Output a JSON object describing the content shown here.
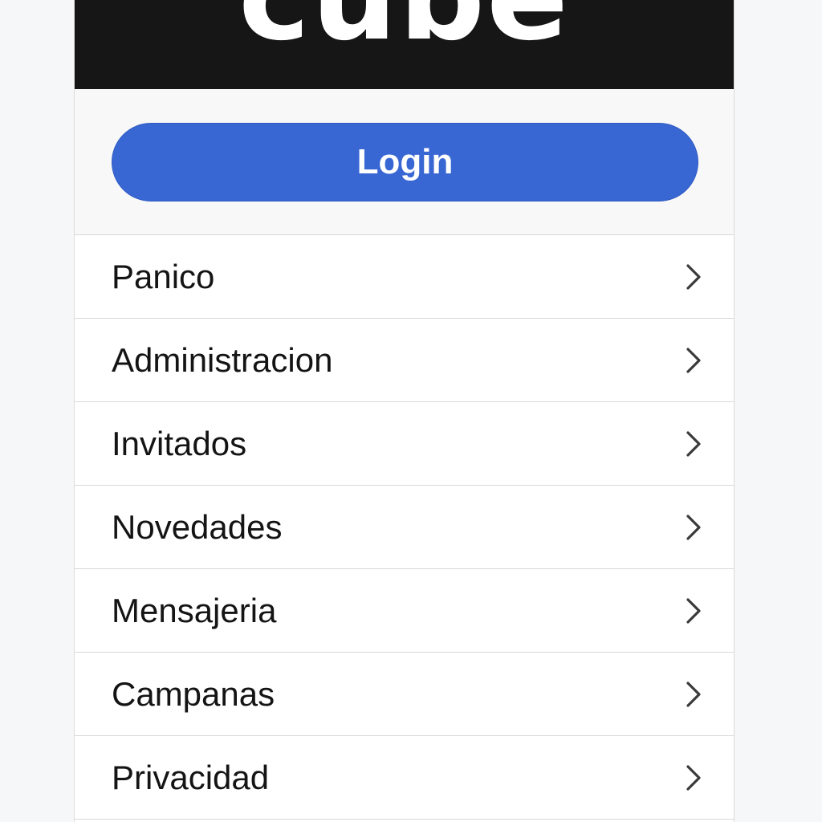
{
  "header": {
    "logo_text": "cube",
    "background_color": "#161616"
  },
  "login": {
    "label": "Login",
    "color": "#3867d4"
  },
  "menu": {
    "items": [
      {
        "label": "Panico",
        "icon": "chevron-right-icon"
      },
      {
        "label": "Administracion",
        "icon": "chevron-right-icon"
      },
      {
        "label": "Invitados",
        "icon": "chevron-right-icon"
      },
      {
        "label": "Novedades",
        "icon": "chevron-right-icon"
      },
      {
        "label": "Mensajeria",
        "icon": "chevron-right-icon"
      },
      {
        "label": "Campanas",
        "icon": "chevron-right-icon"
      },
      {
        "label": "Privacidad",
        "icon": "chevron-right-icon"
      }
    ]
  }
}
